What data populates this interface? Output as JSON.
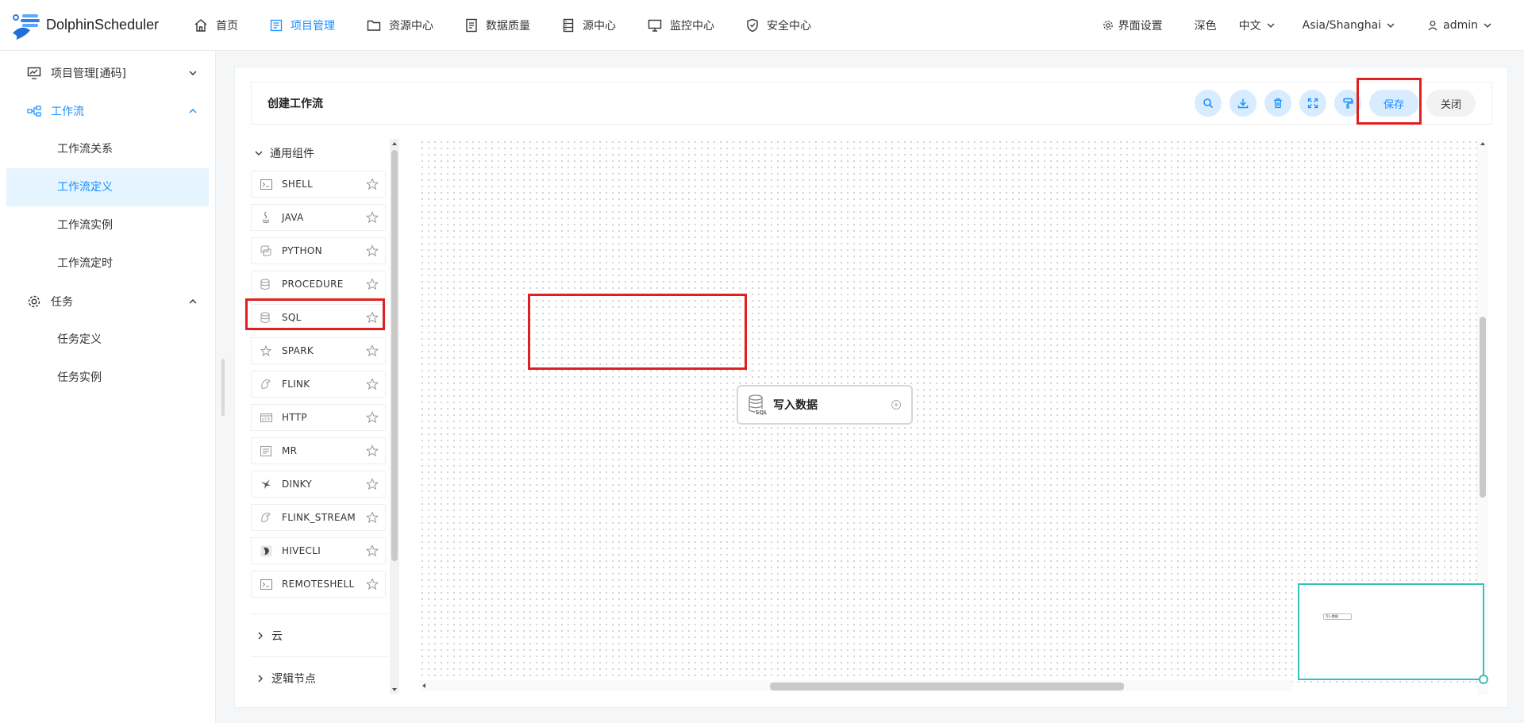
{
  "app": {
    "name": "DolphinScheduler"
  },
  "nav": {
    "items": [
      {
        "label": "首页",
        "icon": "home-icon"
      },
      {
        "label": "项目管理",
        "icon": "project-icon",
        "active": true
      },
      {
        "label": "资源中心",
        "icon": "folder-icon"
      },
      {
        "label": "数据质量",
        "icon": "data-quality-icon"
      },
      {
        "label": "源中心",
        "icon": "datasource-icon"
      },
      {
        "label": "监控中心",
        "icon": "monitor-icon"
      },
      {
        "label": "安全中心",
        "icon": "shield-icon"
      }
    ]
  },
  "header_right": {
    "settings_label": "界面设置",
    "theme_label": "深色",
    "language_label": "中文",
    "timezone_label": "Asia/Shanghai",
    "user_label": "admin"
  },
  "sidebar": {
    "project_group": "项目管理[通码]",
    "workflow_group": "工作流",
    "workflow_items": [
      "工作流关系",
      "工作流定义",
      "工作流实例",
      "工作流定时"
    ],
    "task_group": "任务",
    "task_items": [
      "任务定义",
      "任务实例"
    ]
  },
  "toolbar": {
    "title": "创建工作流",
    "save_label": "保存",
    "close_label": "关闭"
  },
  "panel": {
    "general_group": "通用组件",
    "components": [
      "SHELL",
      "JAVA",
      "PYTHON",
      "PROCEDURE",
      "SQL",
      "SPARK",
      "FLINK",
      "HTTP",
      "MR",
      "DINKY",
      "FLINK_STREAM",
      "HIVECLI",
      "REMOTESHELL"
    ],
    "cloud_group": "云",
    "logic_group": "逻辑节点"
  },
  "canvas": {
    "node_label": "写入数据",
    "node_icon": "database-sql-icon",
    "minimap_node_label": "写入数据"
  },
  "colors": {
    "accent": "#1890ff",
    "highlight": "#e02020",
    "minimap_border": "#36c2b8"
  }
}
